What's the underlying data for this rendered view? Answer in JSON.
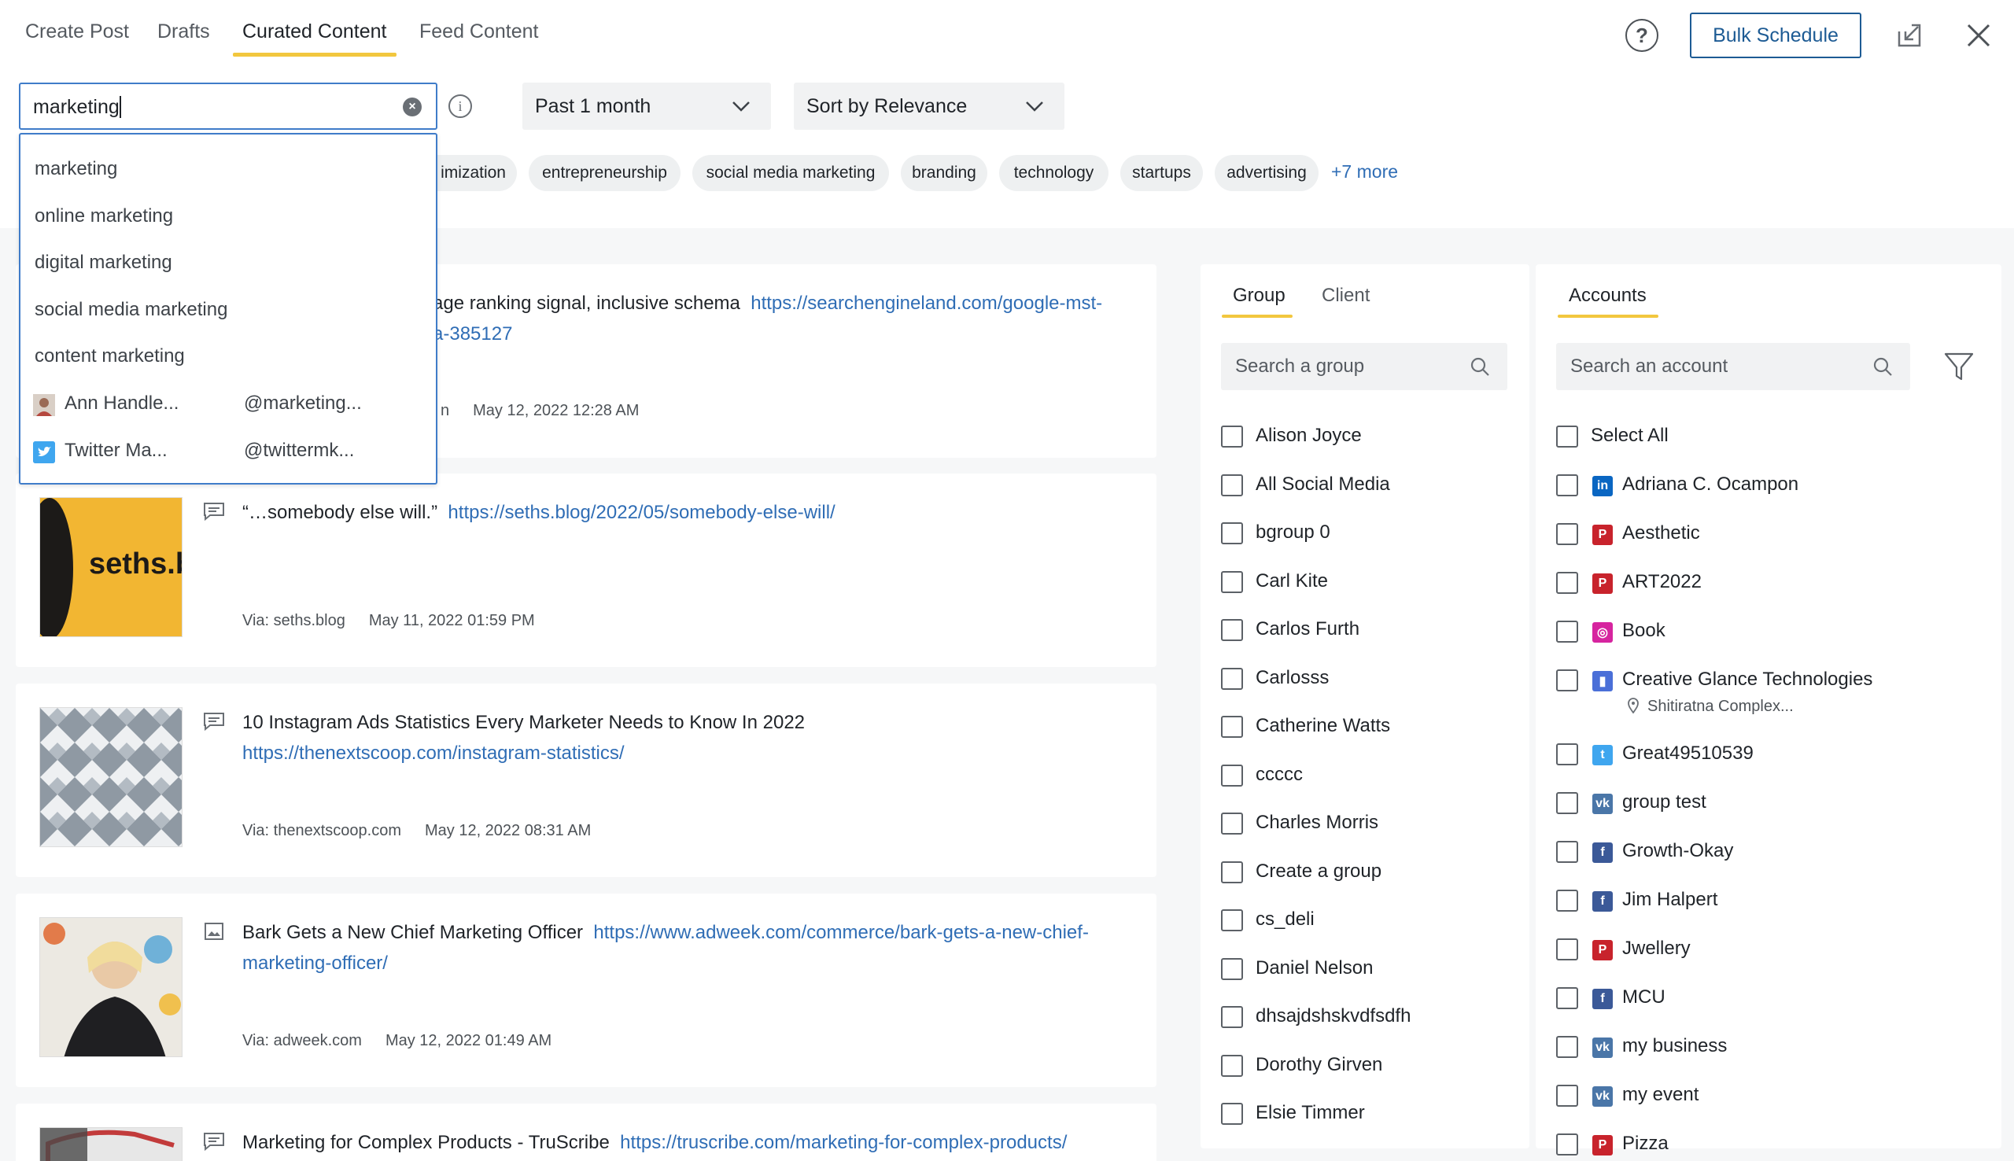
{
  "tabs": [
    {
      "label": "Create Post"
    },
    {
      "label": "Drafts"
    },
    {
      "label": "Curated Content"
    },
    {
      "label": "Feed Content"
    }
  ],
  "toolbar": {
    "help_glyph": "?",
    "bulk_schedule_label": "Bulk Schedule"
  },
  "search": {
    "value": "marketing",
    "clear_glyph": "×",
    "info_glyph": "i"
  },
  "filters": {
    "time_range": "Past 1 month",
    "sort": "Sort by Relevance"
  },
  "chips": [
    {
      "label": "imization"
    },
    {
      "label": "entrepreneurship"
    },
    {
      "label": "social media marketing"
    },
    {
      "label": "branding"
    },
    {
      "label": "technology"
    },
    {
      "label": "startups"
    },
    {
      "label": "advertising"
    }
  ],
  "chips_more": "+7 more",
  "suggestions": {
    "keywords": [
      "marketing",
      "online marketing",
      "digital marketing",
      "social media marketing",
      "content marketing"
    ],
    "profiles": [
      {
        "name": "Ann Handle...",
        "handle": "@marketing..."
      },
      {
        "name": "Twitter Ma...",
        "handle": "@twittermk..."
      }
    ]
  },
  "cards": [
    {
      "title_l1": "age ranking signal, inclusive schema",
      "link_l1": "https://searchengineland.com/google-mst-",
      "link_l2": "a-385127",
      "via": "n",
      "date": "May 12, 2022 12:28 AM"
    },
    {
      "title": "“…somebody else will.”",
      "link": "https://seths.blog/2022/05/somebody-else-will/",
      "via": "Via: seths.blog",
      "date": "May 11, 2022 01:59 PM",
      "thumb_text": "seths.b"
    },
    {
      "title": "10 Instagram Ads Statistics Every Marketer Needs to Know In 2022",
      "link": "https://thenextscoop.com/instagram-statistics/",
      "via": "Via: thenextscoop.com",
      "date": "May 12, 2022 08:31 AM"
    },
    {
      "title": "Bark Gets a New Chief Marketing Officer",
      "link_l1": "https://www.adweek.com/commerce/bark-gets-a-new-chief-",
      "link_l2": "marketing-officer/",
      "via": "Via: adweek.com",
      "date": "May 12, 2022 01:49 AM"
    },
    {
      "title": "Marketing for Complex Products - TruScribe",
      "link": "https://truscribe.com/marketing-for-complex-products/"
    }
  ],
  "group_panel": {
    "tabs": [
      "Group",
      "Client"
    ],
    "search_placeholder": "Search a group",
    "groups": [
      "Alison Joyce",
      "All Social Media",
      "bgroup 0",
      "Carl Kite",
      "Carlos Furth",
      "Carlosss",
      "Catherine Watts",
      "ccccc",
      "Charles Morris",
      "Create a group",
      "cs_deli",
      "Daniel Nelson",
      "dhsajdshskvdfsdfh",
      "Dorothy Girven",
      "Elsie Timmer"
    ]
  },
  "accounts_panel": {
    "tab": "Accounts",
    "search_placeholder": "Search an account",
    "select_all": "Select All",
    "accounts": [
      {
        "name": "Adriana C. Ocampon",
        "network": "linkedin",
        "glyph": "in",
        "color": "#0a66c2"
      },
      {
        "name": "Aesthetic",
        "network": "pinterest",
        "glyph": "P",
        "color": "#c8232c"
      },
      {
        "name": "ART2022",
        "network": "pinterest",
        "glyph": "P",
        "color": "#c8232c"
      },
      {
        "name": "Book",
        "network": "instagram",
        "glyph": "◎",
        "color": "#d6249f"
      },
      {
        "name": "Creative Glance Technologies",
        "network": "google-business",
        "glyph": "▮",
        "color": "#4a6fd8",
        "location": "Shitiratna Complex..."
      },
      {
        "name": "Great49510539",
        "network": "twitter",
        "glyph": "t",
        "color": "#3fa6ef"
      },
      {
        "name": "group test",
        "network": "vk",
        "glyph": "vk",
        "color": "#4a76a8"
      },
      {
        "name": "Growth-Okay",
        "network": "facebook",
        "glyph": "f",
        "color": "#3b5998"
      },
      {
        "name": "Jim Halpert",
        "network": "facebook",
        "glyph": "f",
        "color": "#3b5998"
      },
      {
        "name": "Jwellery",
        "network": "pinterest",
        "glyph": "P",
        "color": "#c8232c"
      },
      {
        "name": "MCU",
        "network": "facebook",
        "glyph": "f",
        "color": "#3b5998"
      },
      {
        "name": "my business",
        "network": "vk",
        "glyph": "vk",
        "color": "#4a76a8"
      },
      {
        "name": "my event",
        "network": "vk",
        "glyph": "vk",
        "color": "#4a76a8"
      },
      {
        "name": "Pizza",
        "network": "pinterest",
        "glyph": "P",
        "color": "#c8232c"
      }
    ]
  }
}
